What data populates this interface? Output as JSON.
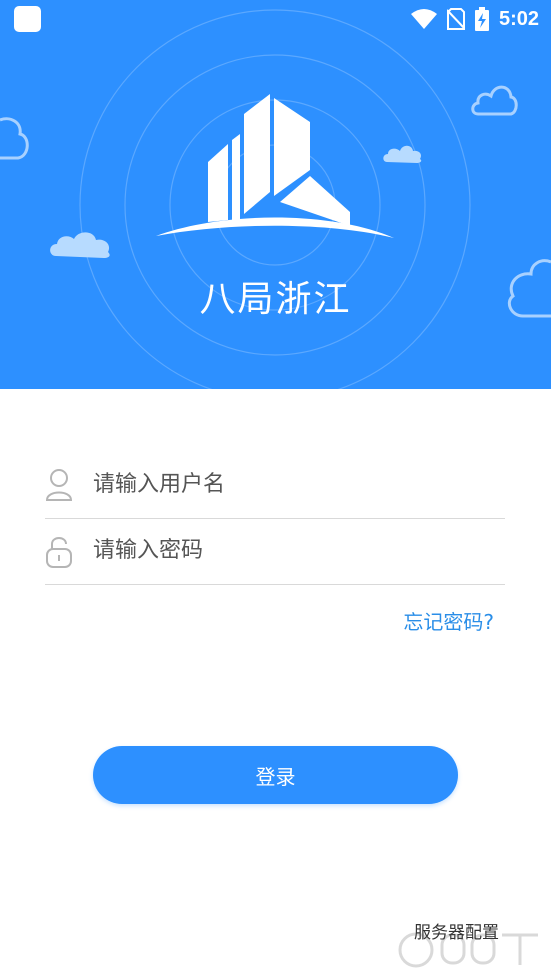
{
  "status_bar": {
    "time": "5:02",
    "icons": [
      "wifi-icon",
      "no-sim-icon",
      "battery-charging-icon"
    ]
  },
  "header": {
    "app_title": "八局浙江",
    "logo": "building-logo-icon"
  },
  "form": {
    "username": {
      "placeholder": "请输入用户名",
      "value": "",
      "icon": "user-icon"
    },
    "password": {
      "placeholder": "请输入密码",
      "value": "",
      "icon": "lock-icon"
    },
    "forgot_password": "忘记密码?",
    "login_button": "登录",
    "server_config": "服务器配置"
  },
  "colors": {
    "primary": "#2d90ff",
    "link": "#2a8ee8",
    "divider": "#d9d9d9"
  }
}
